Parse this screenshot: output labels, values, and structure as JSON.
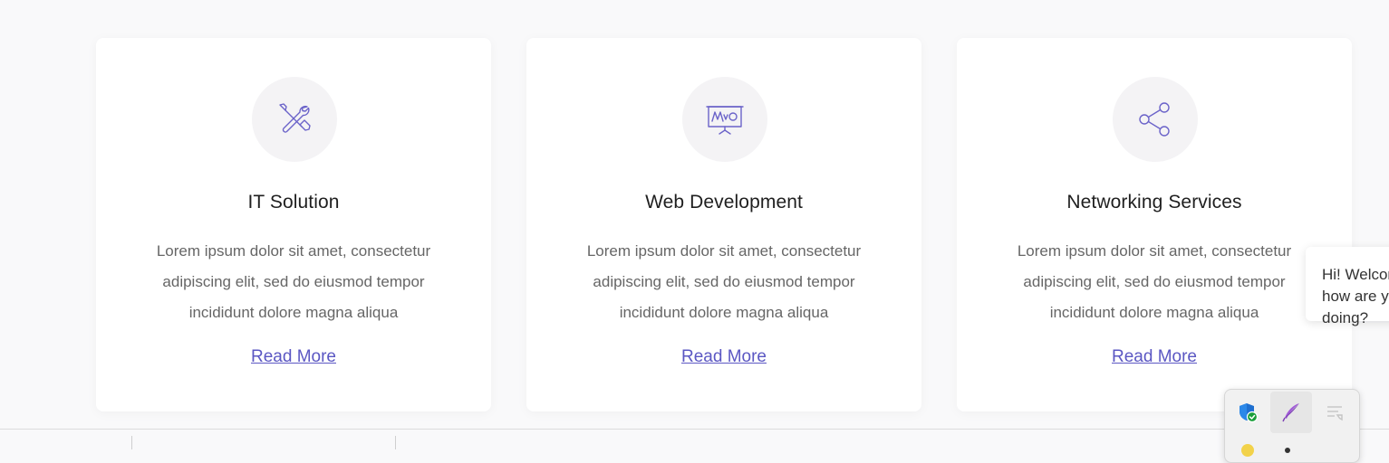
{
  "cards": [
    {
      "title": "IT Solution",
      "icon": "tools-icon",
      "description": "Lorem ipsum dolor sit amet, consectetur adipiscing elit, sed do eiusmod tempor incididunt dolore magna aliqua",
      "link": "Read More"
    },
    {
      "title": "Web Development",
      "icon": "presentation-board-icon",
      "description": "Lorem ipsum dolor sit amet, consectetur adipiscing elit, sed do eiusmod tempor incididunt dolore magna aliqua",
      "link": "Read More"
    },
    {
      "title": "Networking Services",
      "icon": "share-icon",
      "description": "Lorem ipsum dolor sit amet, consectetur adipiscing elit, sed do eiusmod tempor incididunt dolore magna aliqua",
      "link": "Read More"
    }
  ],
  "chat": {
    "message": "Hi! Welcome, how are you doing?"
  },
  "tray": {
    "icons": [
      "security-shield-icon",
      "feather-pen-icon",
      "notification-center-icon"
    ]
  },
  "colors": {
    "accent": "#5b57c3",
    "icon_stroke": "#6b63c9",
    "icon_bg": "#f4f3f5",
    "page_bg": "#f9f9fa"
  }
}
